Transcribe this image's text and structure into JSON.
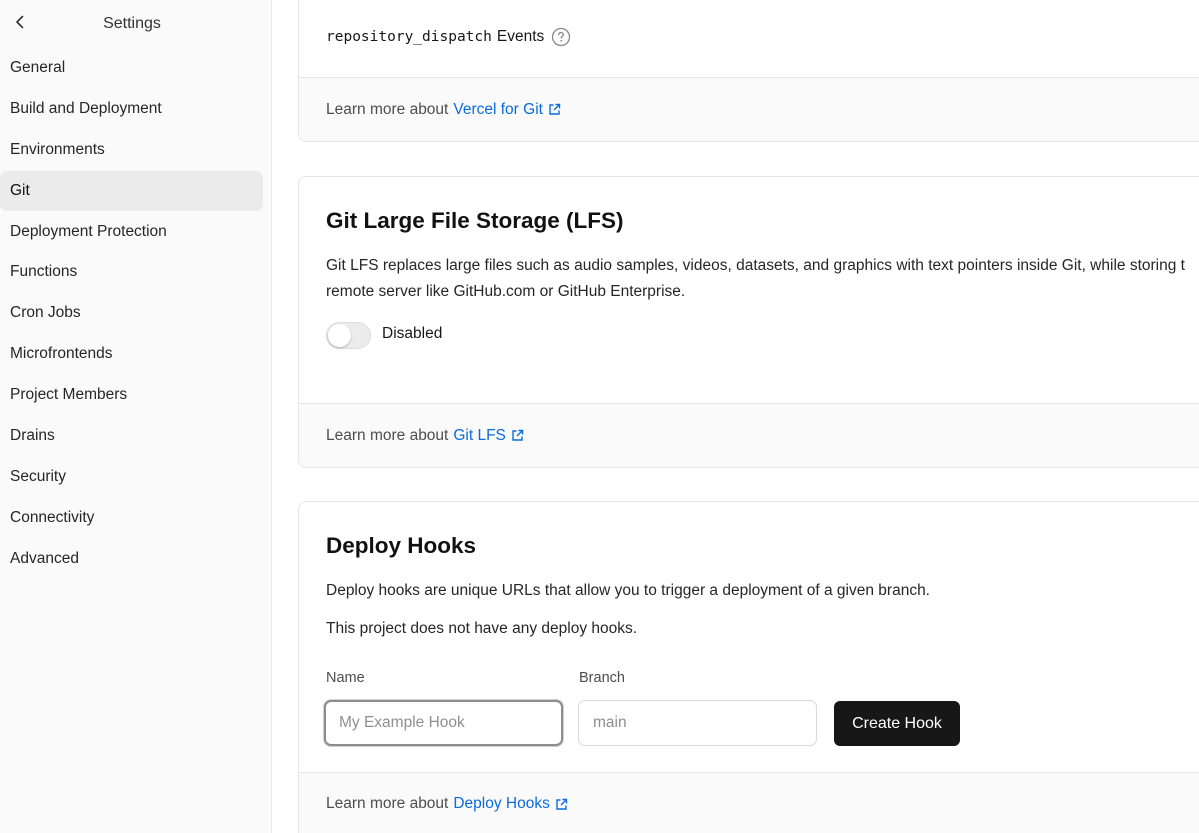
{
  "sidebar": {
    "title": "Settings",
    "items": [
      {
        "label": "General"
      },
      {
        "label": "Build and Deployment"
      },
      {
        "label": "Environments"
      },
      {
        "label": "Git",
        "active": true
      },
      {
        "label": "Deployment Protection"
      },
      {
        "label": "Functions"
      },
      {
        "label": "Cron Jobs"
      },
      {
        "label": "Microfrontends"
      },
      {
        "label": "Project Members"
      },
      {
        "label": "Drains"
      },
      {
        "label": "Security"
      },
      {
        "label": "Connectivity"
      },
      {
        "label": "Advanced"
      }
    ]
  },
  "repo_dispatch": {
    "code": "repository_dispatch",
    "label": "Events",
    "footer_prefix": "Learn more about",
    "footer_link": "Vercel for Git"
  },
  "lfs": {
    "title": "Git Large File Storage (LFS)",
    "description_line1": "Git LFS replaces large files such as audio samples, videos, datasets, and graphics with text pointers inside Git, while storing t",
    "description_line2": "remote server like GitHub.com or GitHub Enterprise.",
    "toggle_label": "Disabled",
    "toggle_on": false,
    "footer_prefix": "Learn more about",
    "footer_link": "Git LFS"
  },
  "deploy_hooks": {
    "title": "Deploy Hooks",
    "description": "Deploy hooks are unique URLs that allow you to trigger a deployment of a given branch.",
    "empty_text": "This project does not have any deploy hooks.",
    "name_label": "Name",
    "name_placeholder": "My Example Hook",
    "branch_label": "Branch",
    "branch_placeholder": "main",
    "create_button": "Create Hook",
    "footer_prefix": "Learn more about",
    "footer_link": "Deploy Hooks"
  },
  "colors": {
    "link": "#0a6cdb",
    "primary_button": "#171717",
    "sidebar_bg": "#fafafa",
    "active_item_bg": "#ebebeb"
  },
  "icons": [
    "chevron-left-icon",
    "help-circle-icon",
    "external-link-icon"
  ]
}
